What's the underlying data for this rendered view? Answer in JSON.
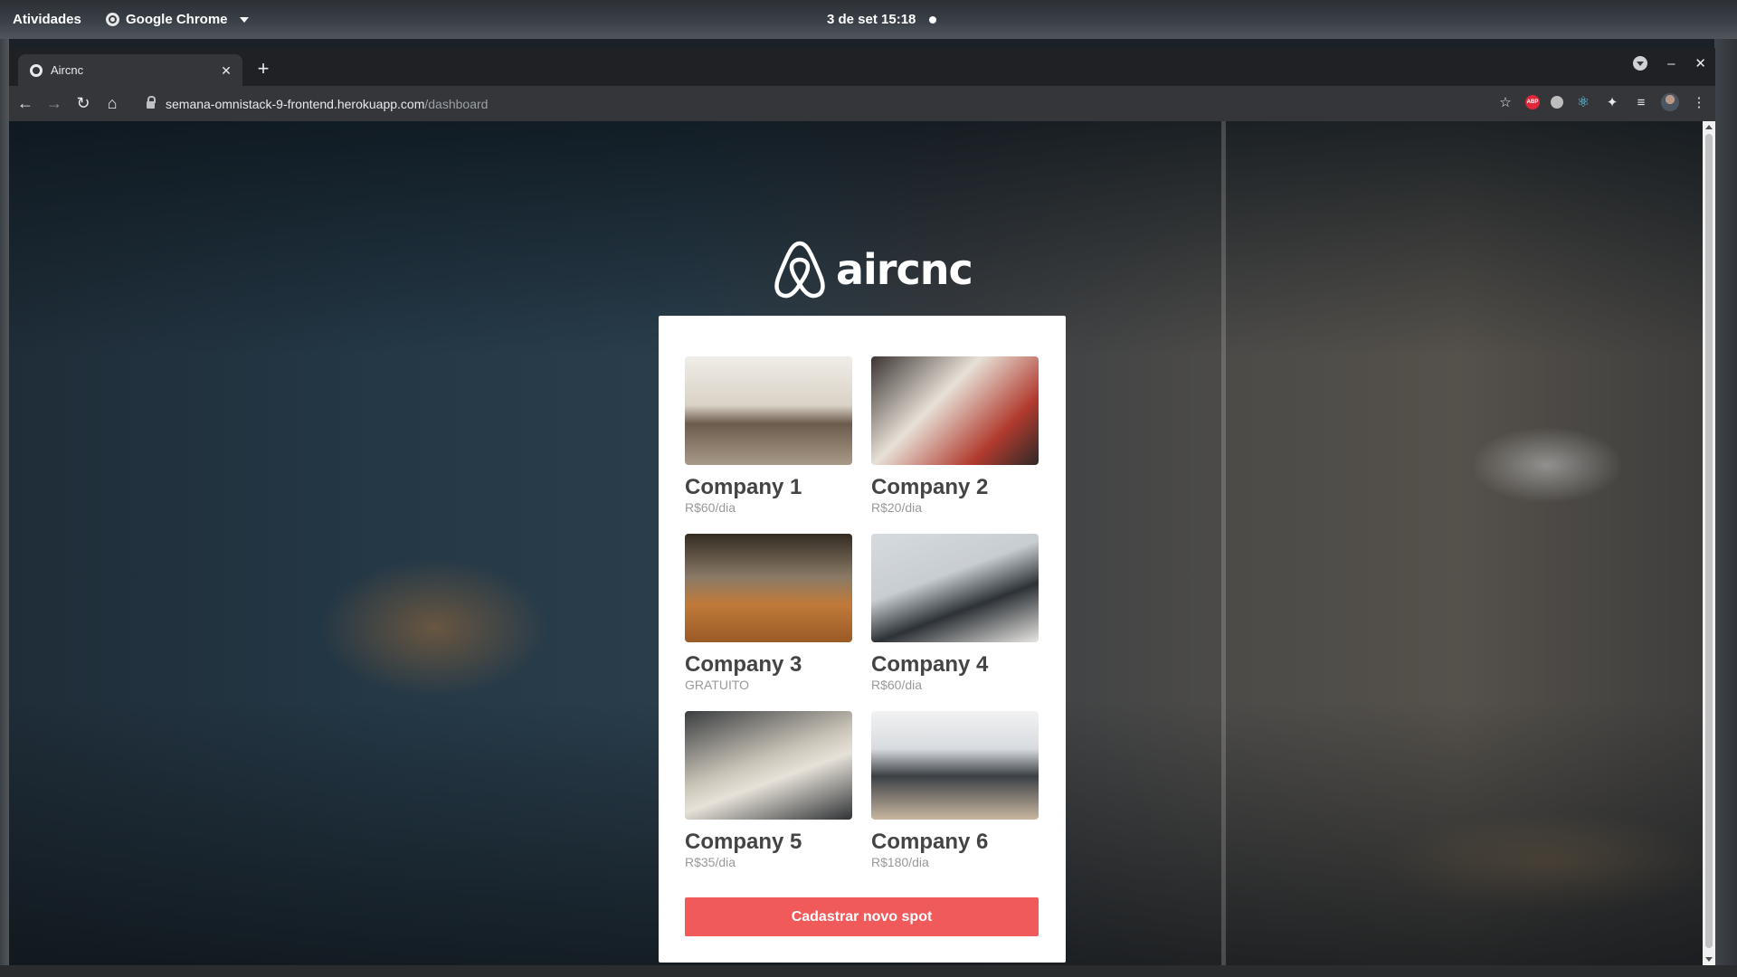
{
  "system": {
    "activities": "Atividades",
    "app_name": "Google Chrome",
    "clock": "3 de set  15:18"
  },
  "browser": {
    "tab_title": "Aircnc",
    "url_host": "semana-omnistack-9-frontend.herokuapp.com",
    "url_path": "/dashboard"
  },
  "page": {
    "logo_text": "aircnc",
    "spots": [
      {
        "name": "Company 1",
        "price": "R$60/dia"
      },
      {
        "name": "Company 2",
        "price": "R$20/dia"
      },
      {
        "name": "Company 3",
        "price": "GRATUITO"
      },
      {
        "name": "Company 4",
        "price": "R$60/dia"
      },
      {
        "name": "Company 5",
        "price": "R$35/dia"
      },
      {
        "name": "Company 6",
        "price": "R$180/dia"
      }
    ],
    "new_spot_button": "Cadastrar novo spot"
  },
  "colors": {
    "accent": "#f05a5b",
    "card_bg": "#ffffff",
    "title_text": "#444444",
    "price_text": "#999999"
  },
  "icons": {
    "logo": "airbnb-belo-icon",
    "extensions": [
      "adblock-plus-icon",
      "ghost-icon",
      "react-devtools-icon",
      "puzzle-icon",
      "media-icon",
      "profile-avatar-icon",
      "more-vert-icon"
    ]
  }
}
